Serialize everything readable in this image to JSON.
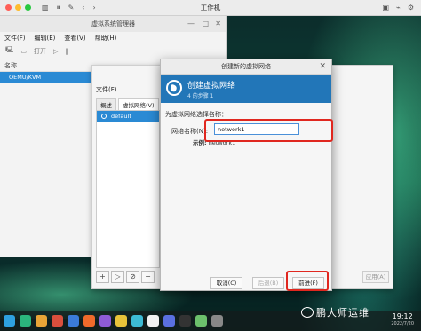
{
  "host": {
    "title": "工作机"
  },
  "vmm": {
    "title": "虚拟系统管理器",
    "menu": [
      "文件(F)",
      "编辑(E)",
      "查看(V)",
      "帮助(H)"
    ],
    "toolbar_open": "打开",
    "name_header": "名称",
    "connection": "QEMU/KVM"
  },
  "details": {
    "menu_file": "文件(F)",
    "tabs": [
      "概述",
      "虚拟网络(V)",
      "存"
    ],
    "network_item": "default",
    "apply_label": "应用(A)"
  },
  "dialog": {
    "title": "创建新的虚拟网络",
    "heading": "创建虚拟网络",
    "step": "4 的步骤 1",
    "prompt": "为虚拟网络选择名称：",
    "name_label": "网络名称(N):",
    "name_value": "network1",
    "example_label": "示例:",
    "example_value": "network1",
    "cancel_label": "取消(C)",
    "back_label": "后退(B)",
    "forward_label": "前进(F)"
  },
  "dock": {
    "time": "19:12",
    "date": "2022/7/20"
  },
  "watermark": "鹏大师运维",
  "colors": {
    "banner": "#2276b8",
    "selection": "#2a8ad4",
    "highlight": "#e0271f"
  }
}
